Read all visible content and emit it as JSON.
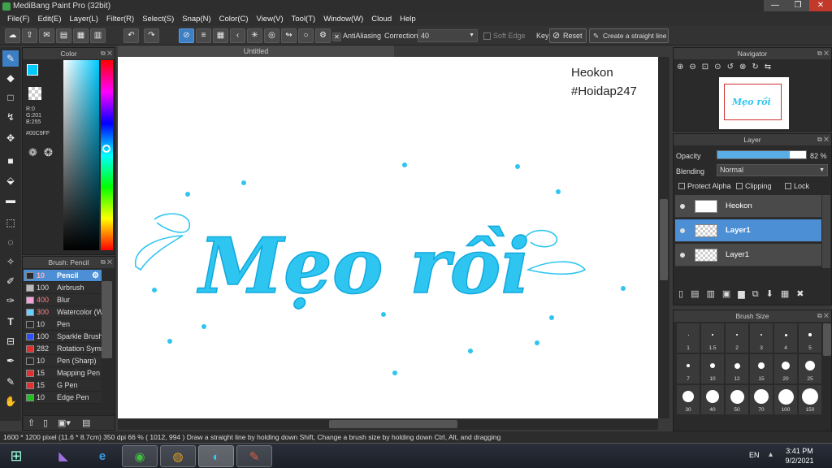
{
  "window": {
    "title": "MediBang Paint Pro (32bit)"
  },
  "menu": [
    "File(F)",
    "Edit(E)",
    "Layer(L)",
    "Filter(R)",
    "Select(S)",
    "Snap(N)",
    "Color(C)",
    "View(V)",
    "Tool(T)",
    "Window(W)",
    "Cloud",
    "Help"
  ],
  "toolbar": {
    "antialiasing_label": "AntiAliasing",
    "correction_label": "Correction",
    "correction_value": "40",
    "soft_edge_label": "Soft Edge",
    "key_label": "Key",
    "reset_label": "Reset",
    "straight_line_label": "Create a straight line"
  },
  "color_panel": {
    "title": "Color",
    "rgb_r": "R:0",
    "rgb_g": "G:201",
    "rgb_b": "B:255",
    "hex": "#00C9FF",
    "current_color": "#00C9FF"
  },
  "brush_panel": {
    "title": "Brush: Pencil",
    "items": [
      {
        "size": "10",
        "name": "Pencil",
        "color": "#2a2a2a",
        "size_color": "#ffb0b0"
      },
      {
        "size": "100",
        "name": "Airbrush",
        "color": "#bbbbbb",
        "size_color": "#dddddd"
      },
      {
        "size": "400",
        "name": "Blur",
        "color": "#f5a0d8",
        "size_color": "#ff8080"
      },
      {
        "size": "300",
        "name": "Watercolor (W",
        "color": "#6ad0ff",
        "size_color": "#ff8080"
      },
      {
        "size": "10",
        "name": "Pen",
        "color": "#2a2a2a",
        "size_color": "#dddddd"
      },
      {
        "size": "100",
        "name": "Sparkle Brush",
        "color": "#2a50ff",
        "size_color": "#dddddd"
      },
      {
        "size": "282",
        "name": "Rotation Symm",
        "color": "#e03030",
        "size_color": "#dddddd"
      },
      {
        "size": "10",
        "name": "Pen (Sharp)",
        "color": "#2a2a2a",
        "size_color": "#dddddd"
      },
      {
        "size": "15",
        "name": "Mapping Pen",
        "color": "#e03030",
        "size_color": "#dddddd"
      },
      {
        "size": "15",
        "name": "G Pen",
        "color": "#e03030",
        "size_color": "#dddddd"
      },
      {
        "size": "10",
        "name": "Edge Pen",
        "color": "#20c020",
        "size_color": "#dddddd"
      }
    ]
  },
  "canvas": {
    "tab_title": "Untitled",
    "watermark_line1": "Heokon",
    "watermark_line2": "#Hoidap247",
    "lettering": "Mẹo rồi",
    "ink_color": "#22c3ee"
  },
  "navigator": {
    "title": "Navigator"
  },
  "layer_panel": {
    "title": "Layer",
    "opacity_label": "Opacity",
    "opacity_value": "82 %",
    "opacity_fraction": 0.82,
    "blending_label": "Blending",
    "blending_value": "Normal",
    "protect_alpha_label": "Protect Alpha",
    "clipping_label": "Clipping",
    "lock_label": "Lock",
    "layers": [
      {
        "name": "Heokon",
        "selected": false
      },
      {
        "name": "Layer1",
        "selected": true
      },
      {
        "name": "Layer1",
        "selected": false
      }
    ]
  },
  "brush_size": {
    "title": "Brush Size",
    "sizes": [
      "1",
      "1.5",
      "2",
      "3",
      "4",
      "5",
      "7",
      "10",
      "12",
      "15",
      "20",
      "25",
      "30",
      "40",
      "50",
      "70",
      "100",
      "150"
    ]
  },
  "status": {
    "text": "1600 * 1200 pixel  (11.6 * 8.7cm)  350 dpi  66 %  ( 1012, 994 )  Draw a straight line by holding down Shift, Change a brush size by holding down Ctrl, Alt, and dragging"
  },
  "taskbar": {
    "lang": "EN",
    "time": "3:41 PM",
    "date": "9/2/2021"
  }
}
